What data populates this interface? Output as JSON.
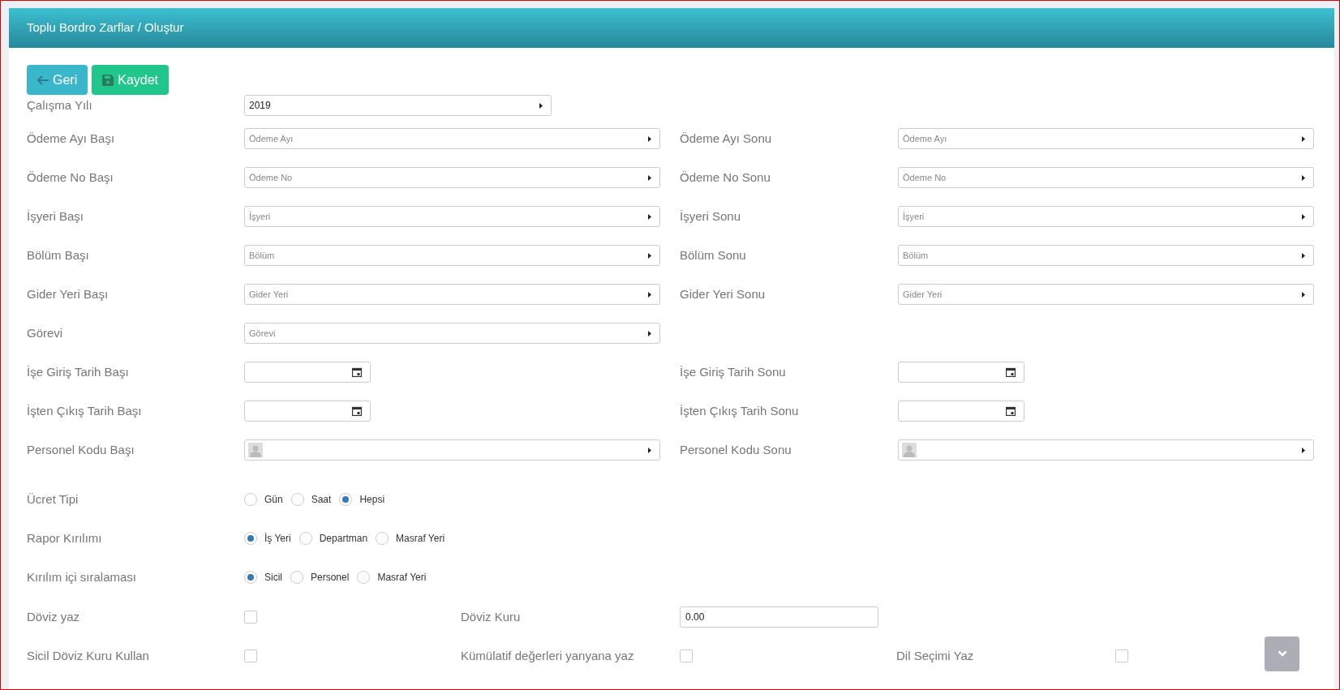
{
  "header": {
    "title": "Toplu Bordro Zarflar / Oluştur"
  },
  "toolbar": [
    {
      "kind": "back",
      "label": "Geri"
    },
    {
      "kind": "save",
      "label": "Kaydet"
    }
  ],
  "year": {
    "label": "Çalışma Yılı",
    "value": "2019"
  },
  "range_rows": [
    {
      "left": {
        "kind": "select",
        "label": "Ödeme Ayı Başı",
        "placeholder": "Ödeme Ayı"
      },
      "right": {
        "kind": "select",
        "label": "Ödeme Ayı Sonu",
        "placeholder": "Ödeme Ayı"
      }
    },
    {
      "left": {
        "kind": "select",
        "label": "Ödeme No Başı",
        "placeholder": "Ödeme No"
      },
      "right": {
        "kind": "select",
        "label": "Ödeme No Sonu",
        "placeholder": "Ödeme No"
      }
    },
    {
      "left": {
        "kind": "select",
        "label": "İşyeri Başı",
        "placeholder": "İşyeri"
      },
      "right": {
        "kind": "select",
        "label": "İşyeri Sonu",
        "placeholder": "İşyeri"
      }
    },
    {
      "left": {
        "kind": "select",
        "label": "Bölüm Başı",
        "placeholder": "Bölüm"
      },
      "right": {
        "kind": "select",
        "label": "Bölüm Sonu",
        "placeholder": "Bölüm"
      }
    },
    {
      "left": {
        "kind": "select",
        "label": "Gider Yeri Başı",
        "placeholder": "Gider Yeri"
      },
      "right": {
        "kind": "select",
        "label": "Gider Yeri Sonu",
        "placeholder": "Gider Yeri"
      }
    },
    {
      "left": {
        "kind": "select",
        "label": "Görevi",
        "placeholder": "Görevi"
      }
    },
    {
      "left": {
        "kind": "date",
        "label": "İşe Giriş Tarih Başı"
      },
      "right": {
        "kind": "date",
        "label": "İşe Giriş Tarih Sonu"
      }
    },
    {
      "left": {
        "kind": "date",
        "label": "İşten Çıkış Tarih Başı"
      },
      "right": {
        "kind": "date",
        "label": "İşten Çıkış Tarih Sonu"
      }
    },
    {
      "left": {
        "kind": "person",
        "label": "Personel Kodu Başı"
      },
      "right": {
        "kind": "person",
        "label": "Personel Kodu Sonu"
      }
    }
  ],
  "radio_groups": [
    {
      "label": "Ücret Tipi",
      "options": [
        {
          "label": "Gün",
          "selected": false
        },
        {
          "label": "Saat",
          "selected": false
        },
        {
          "label": "Hepsi",
          "selected": true
        }
      ]
    },
    {
      "label": "Rapor Kırılımı",
      "options": [
        {
          "label": "İş Yeri",
          "selected": true
        },
        {
          "label": "Departman",
          "selected": false
        },
        {
          "label": "Masraf Yeri",
          "selected": false
        }
      ]
    },
    {
      "label": "Kırılım içi sıralaması",
      "options": [
        {
          "label": "Sicil",
          "selected": true
        },
        {
          "label": "Personel",
          "selected": false
        },
        {
          "label": "Masraf Yeri",
          "selected": false
        }
      ]
    }
  ],
  "option_rows": [
    [
      {
        "kind": "checkbox",
        "label": "Döviz yaz",
        "checked": false
      },
      {
        "kind": "number",
        "label": "Döviz Kuru",
        "value": "0.00"
      }
    ],
    [
      {
        "kind": "checkbox",
        "label": "Sicil Döviz Kuru Kullan",
        "checked": false
      },
      {
        "kind": "checkbox",
        "label": "Kümülatif değerleri yanyana yaz",
        "checked": false
      },
      {
        "kind": "checkbox",
        "label": "Dil Seçimi Yaz",
        "checked": false
      }
    ]
  ]
}
